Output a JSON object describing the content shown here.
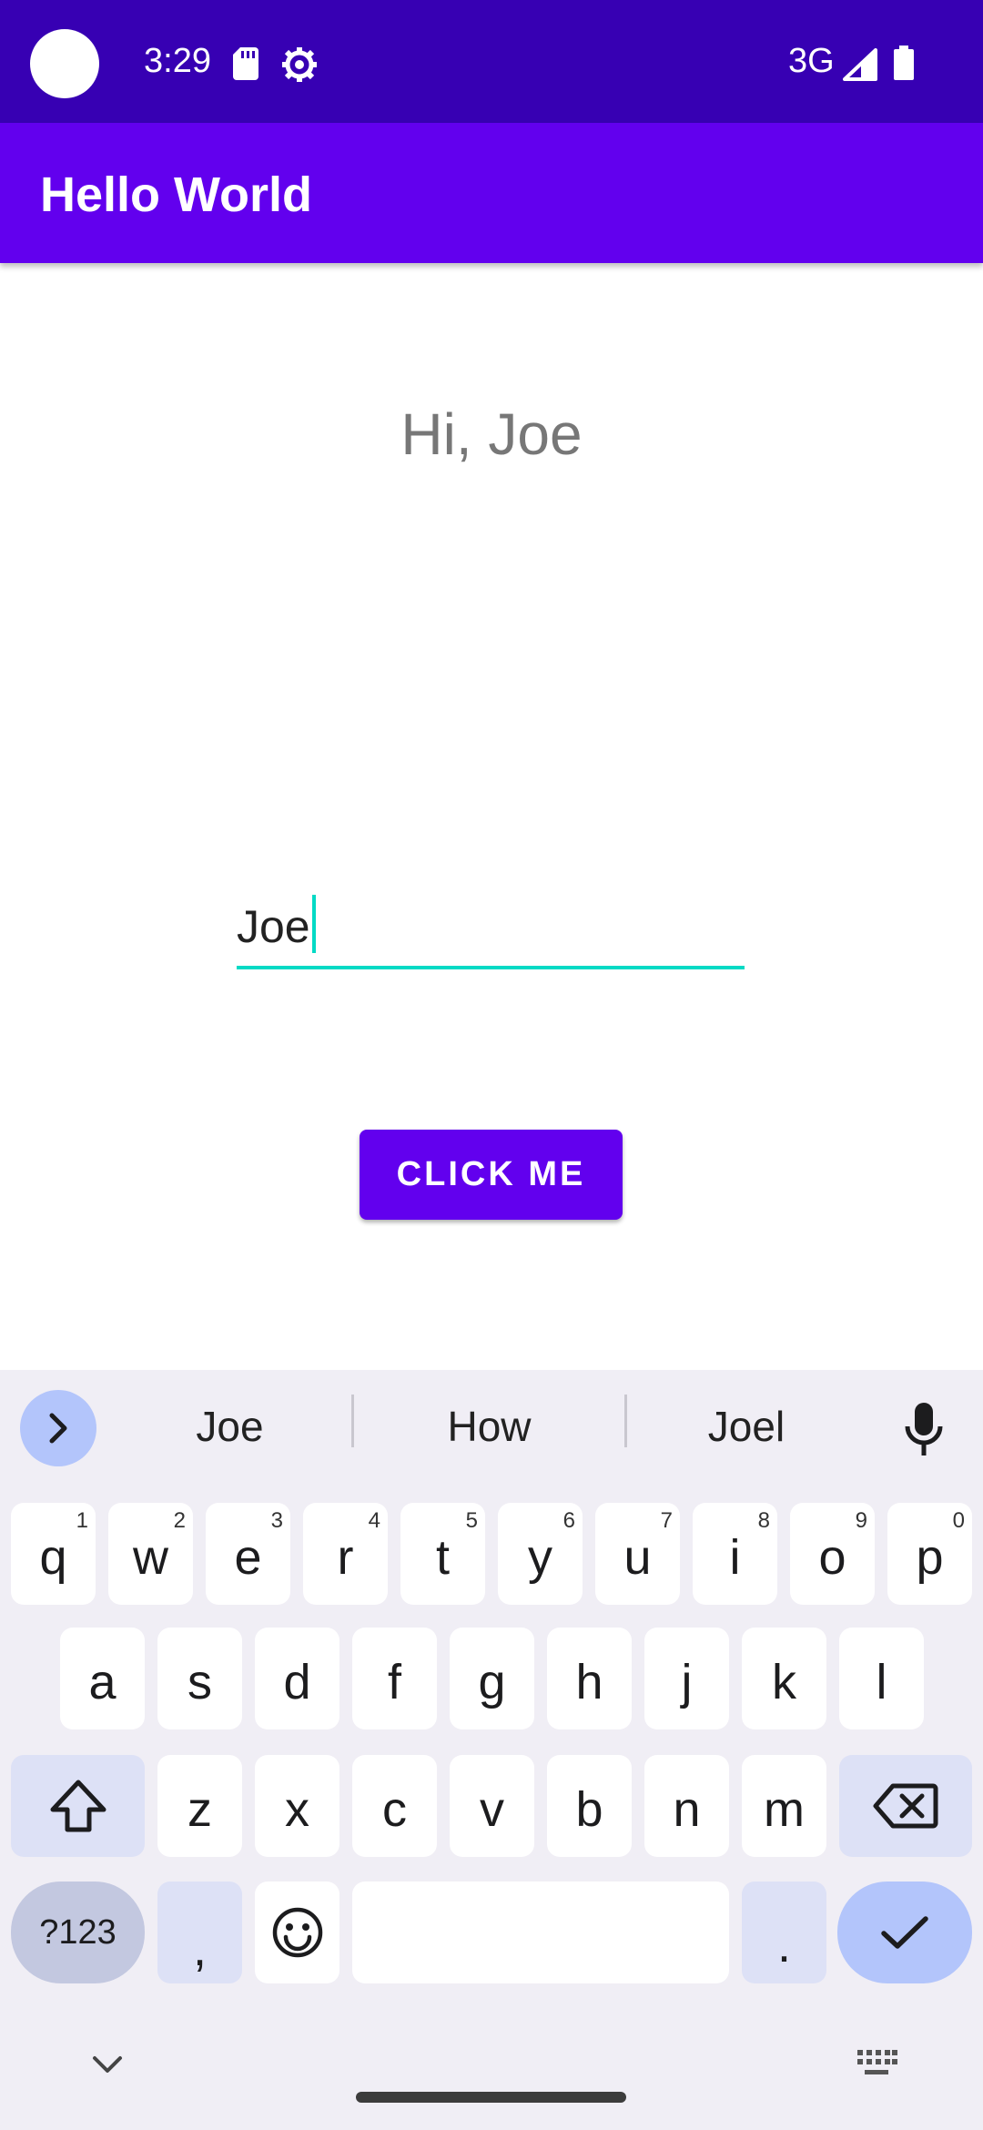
{
  "status_bar": {
    "time": "3:29",
    "network": "3G",
    "icons": [
      "sd-card-icon",
      "settings-gear-icon",
      "signal-icon",
      "battery-icon"
    ],
    "background": "#3700b3"
  },
  "app_bar": {
    "title": "Hello World",
    "background": "#6200ee"
  },
  "main": {
    "greeting": "Hi, Joe",
    "name_input": {
      "value": "Joe",
      "underline_color": "#03dac5"
    },
    "button_label": "CLICK ME"
  },
  "keyboard": {
    "suggestions": [
      "Joe",
      "How",
      "Joel"
    ],
    "row1": [
      {
        "letter": "q",
        "hint": "1"
      },
      {
        "letter": "w",
        "hint": "2"
      },
      {
        "letter": "e",
        "hint": "3"
      },
      {
        "letter": "r",
        "hint": "4"
      },
      {
        "letter": "t",
        "hint": "5"
      },
      {
        "letter": "y",
        "hint": "6"
      },
      {
        "letter": "u",
        "hint": "7"
      },
      {
        "letter": "i",
        "hint": "8"
      },
      {
        "letter": "o",
        "hint": "9"
      },
      {
        "letter": "p",
        "hint": "0"
      }
    ],
    "row2": [
      "a",
      "s",
      "d",
      "f",
      "g",
      "h",
      "j",
      "k",
      "l"
    ],
    "row3": [
      "z",
      "x",
      "c",
      "v",
      "b",
      "n",
      "m"
    ],
    "symbols_label": "?123",
    "comma_label": ",",
    "period_label": "."
  }
}
